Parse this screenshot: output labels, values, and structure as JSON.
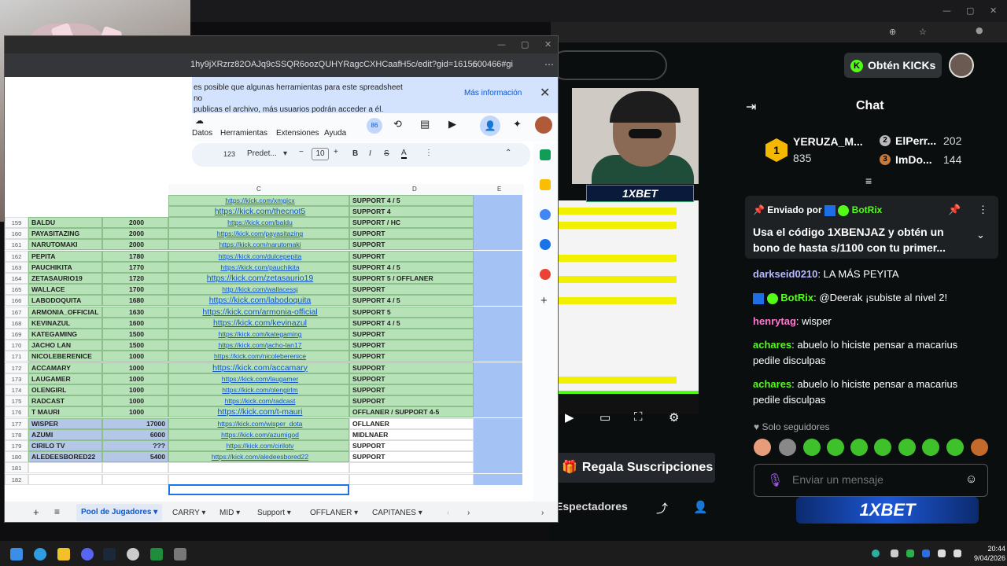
{
  "sheets": {
    "url": "1hy9jXRzrz82OAJq9cSSQR6oozQUHYRagcCXHCaafH5c/edit?gid=1615600466#gi",
    "notice_line1": "es posible que algunas herramientas para este spreadsheet no",
    "notice_line2": "publicas el archivo, más usuarios podrán acceder a él.",
    "notice_more": "Más información",
    "menu": [
      "Datos",
      "Herramientas",
      "Extensiones",
      "Ayuda"
    ],
    "collaborators_badge": "86",
    "toolbar": {
      "num_format": "123",
      "font": "Predet...",
      "font_size": "10"
    },
    "columns": [
      "C",
      "D",
      "E"
    ],
    "rows": [
      {
        "n": "159",
        "name": "BALDU",
        "mmr": "2000",
        "url": "https://kick.com/baldu",
        "role": "SUPPORT / HC",
        "big": false,
        "blue": false
      },
      {
        "n": "160",
        "name": "PAYASITAZING",
        "mmr": "2000",
        "url": "https://kick.com/payasitazing",
        "role": "SUPPORT",
        "big": false,
        "blue": false
      },
      {
        "n": "161",
        "name": "NARUTOMAKI",
        "mmr": "2000",
        "url": "https://kick.com/narutomaki",
        "role": "SUPPORT",
        "big": false,
        "blue": false
      },
      {
        "n": "162",
        "name": "PEPITA",
        "mmr": "1780",
        "url": "https://kick.com/dulcepepita",
        "role": "SUPPORT",
        "big": false,
        "blue": false
      },
      {
        "n": "163",
        "name": "PAUCHIKITA",
        "mmr": "1770",
        "url": "https://kick.com/pauchikita",
        "role": "SUPPORT 4 / 5",
        "big": false,
        "blue": false
      },
      {
        "n": "164",
        "name": "ZETASAURIO19",
        "mmr": "1720",
        "url": "https://kick.com/zetasaurio19",
        "role": "SUPPORT 5 / OFFLANER",
        "big": true,
        "blue": false
      },
      {
        "n": "165",
        "name": "WALLACE",
        "mmr": "1700",
        "url": "http://kick.com/wallacessj",
        "role": "SUPPORT",
        "big": false,
        "blue": false
      },
      {
        "n": "166",
        "name": "LABODOQUITA",
        "mmr": "1680",
        "url": "https://kick.com/labodoquita",
        "role": "SUPPORT 4 / 5",
        "big": true,
        "blue": false
      },
      {
        "n": "167",
        "name": "ARMONIA_OFFICIAL",
        "mmr": "1630",
        "url": "https://kick.com/armonia-official",
        "role": "SUPPORT 5",
        "big": true,
        "blue": false
      },
      {
        "n": "168",
        "name": "KEVINAZUL",
        "mmr": "1600",
        "url": "https://kick.com/kevinazul",
        "role": "SUPPORT 4 / 5",
        "big": true,
        "blue": false
      },
      {
        "n": "169",
        "name": "KATEGAMING",
        "mmr": "1500",
        "url": "https://kick.com/kategaming",
        "role": "SUPPORT",
        "big": false,
        "blue": false
      },
      {
        "n": "170",
        "name": "JACHO LAN",
        "mmr": "1500",
        "url": "https://kick.com/jacho-lan17",
        "role": "SUPPORT",
        "big": false,
        "blue": false
      },
      {
        "n": "171",
        "name": "NICOLEBERENICE",
        "mmr": "1000",
        "url": "https://kick.com/nicoleberenice",
        "role": "SUPPORT",
        "big": false,
        "blue": false
      },
      {
        "n": "172",
        "name": "ACCAMARY",
        "mmr": "1000",
        "url": "https://kick.com/accamary",
        "role": "SUPPORT",
        "big": true,
        "blue": false
      },
      {
        "n": "173",
        "name": "LAUGAMER",
        "mmr": "1000",
        "url": "https://kick.com/laugamer",
        "role": "SUPPORT",
        "big": false,
        "blue": false
      },
      {
        "n": "174",
        "name": "OLENGIRL",
        "mmr": "1000",
        "url": "https://kick.com/olengirlm",
        "role": "SUPPORT",
        "big": false,
        "blue": false
      },
      {
        "n": "175",
        "name": "RADCAST",
        "mmr": "1000",
        "url": "https://kick.com/radcast",
        "role": "SUPPORT",
        "big": false,
        "blue": false
      },
      {
        "n": "176",
        "name": "T MAURI",
        "mmr": "1000",
        "url": "https://kick.com/t-mauri",
        "role": "OFFLANER / SUPPORT 4-5",
        "big": true,
        "blue": false
      },
      {
        "n": "177",
        "name": "WISPER",
        "mmr": "17000",
        "url": "https://kick.com/wisper_dota",
        "role": "OFLLANER",
        "big": false,
        "blue": true
      },
      {
        "n": "178",
        "name": "AZUMI",
        "mmr": "6000",
        "url": "https://kick.com/azumigod",
        "role": "MIDLNAER",
        "big": false,
        "blue": true
      },
      {
        "n": "179",
        "name": "CIRILO TV",
        "mmr": "???",
        "url": "https://kick.com/cirilotv",
        "role": "SUPPORT",
        "big": false,
        "blue": true
      },
      {
        "n": "180",
        "name": "ALEDEESBORED22",
        "mmr": "5400",
        "url": "https://kick.com/aledeesbored22",
        "role": "SUPPORT",
        "big": false,
        "blue": true
      },
      {
        "n": "181",
        "name": "",
        "mmr": "",
        "url": "",
        "role": "",
        "big": false,
        "blue": false,
        "empty": true
      },
      {
        "n": "182",
        "name": "",
        "mmr": "",
        "url": "",
        "role": "",
        "big": false,
        "blue": false,
        "empty": true
      }
    ],
    "top_partial": {
      "url": "https://kick.com/xmgicx",
      "role": "SUPPORT 4 / 5",
      "url2": "https://kick.com/thecnot5",
      "role2": "SUPPORT 4"
    },
    "tabs": [
      "Pool de Jugadores",
      "CARRY",
      "MID",
      "Support",
      "OFFLANER",
      "CAPITANES"
    ]
  },
  "stream": {
    "overlay_brand": "1XBET",
    "gift_subs_label": "Regala Suscripciones",
    "viewers_label": "Espectadores"
  },
  "kick": {
    "get_kicks_label": "Obtén KICKs",
    "chat_title": "Chat",
    "gifters": [
      {
        "rank": "1",
        "name": "YERUZA_M...",
        "count": "835"
      },
      {
        "rank": "2",
        "name": "ElPerr...",
        "count": "202"
      },
      {
        "rank": "3",
        "name": "ImDo...",
        "count": "144"
      }
    ],
    "pinned": {
      "sent_by": "Enviado por",
      "bot": "BotRix",
      "text": "Usa el código 1XBENJAZ y obtén un bono de hasta s/1100 con tu primer..."
    },
    "messages": [
      {
        "user": "darkseid0210",
        "text": "LA MÁS PEYITA",
        "color": "#b9b9ff"
      },
      {
        "user": "BotRix",
        "text": "@Deerak ¡subiste al nivel 2!",
        "color": "#53fc18"
      },
      {
        "user": "henrytag",
        "text": "wisper",
        "color": "#ff77d0"
      },
      {
        "user": "achares",
        "text": "abuelo lo hiciste pensar a macarius pedile disculpas",
        "color": "#53fc18"
      },
      {
        "user": "achares",
        "text": "abuelo lo hiciste pensar a macarius pedile disculpas",
        "color": "#53fc18"
      }
    ],
    "followers_only": "Solo seguidores",
    "chat_placeholder": "Enviar un mensaje",
    "banner_brand": "1XBET"
  },
  "taskbar": {
    "time": "20:44",
    "date": "9/04/2026"
  }
}
